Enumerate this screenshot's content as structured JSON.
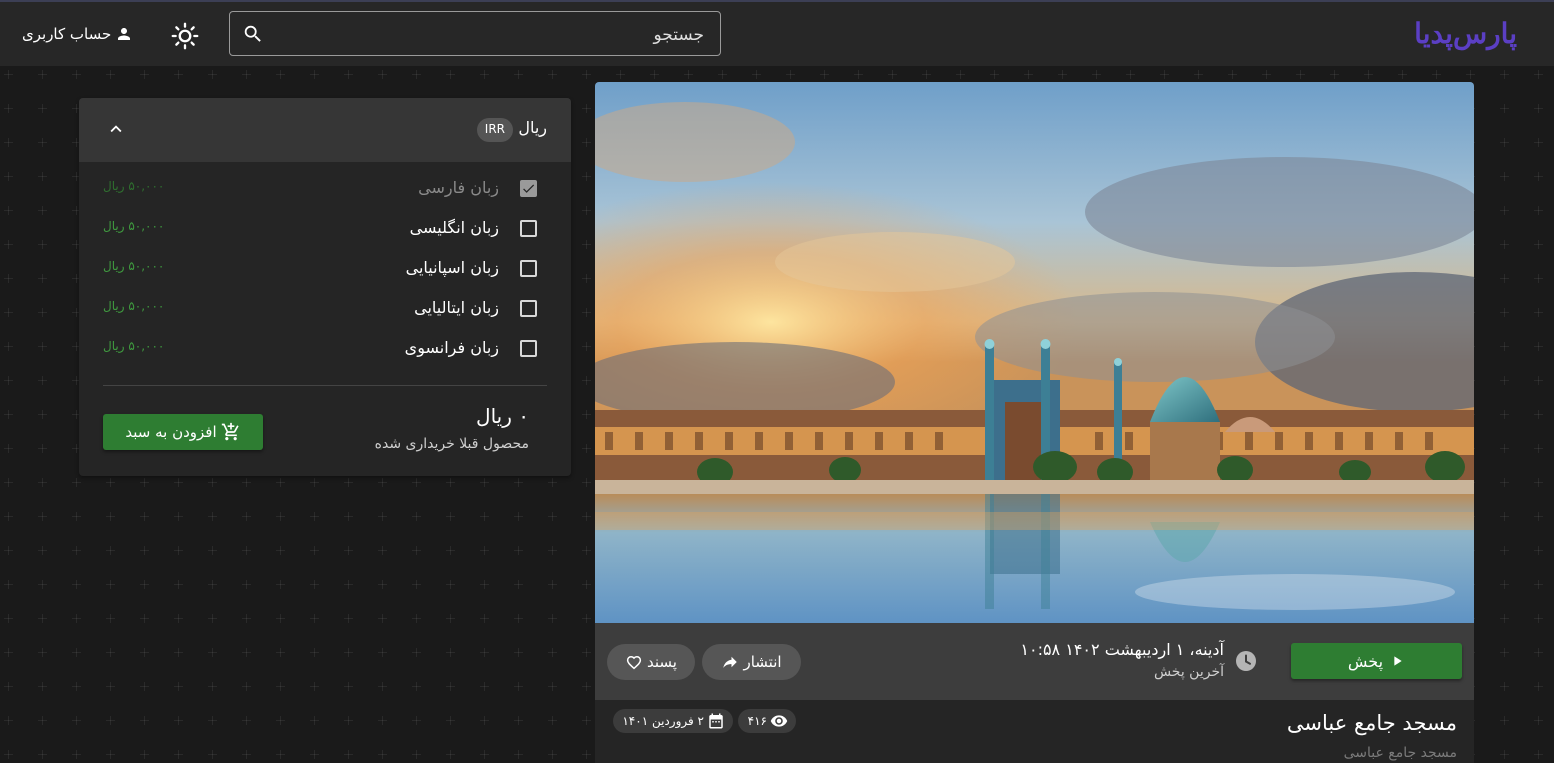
{
  "header": {
    "logo_text": "پارس‌پدیا",
    "search_placeholder": "جستجو",
    "account_label": "حساب کاربری"
  },
  "purchase": {
    "currency_name": "ریال",
    "currency_code": "IRR",
    "options": [
      {
        "label": "زبان فارسی",
        "price": "۵۰,۰۰۰ ریال",
        "checked": true,
        "disabled": true
      },
      {
        "label": "زبان انگلیسی",
        "price": "۵۰,۰۰۰ ریال",
        "checked": false,
        "disabled": false
      },
      {
        "label": "زبان اسپانیایی",
        "price": "۵۰,۰۰۰ ریال",
        "checked": false,
        "disabled": false
      },
      {
        "label": "زبان ایتالیایی",
        "price": "۵۰,۰۰۰ ریال",
        "checked": false,
        "disabled": false
      },
      {
        "label": "زبان فرانسوی",
        "price": "۵۰,۰۰۰ ریال",
        "checked": false,
        "disabled": false
      }
    ],
    "total": "۰ ریال",
    "total_note": "محصول قبلا خریداری شده",
    "add_to_cart_label": "افزودن به سبد"
  },
  "video": {
    "play_label": "پخش",
    "last_play_date": "آدینه، ۱ اردیبهشت ۱۴۰۲ ۱۰:۵۸",
    "last_play_label": "آخرین پخش",
    "share_label": "انتشار",
    "like_label": "پسند",
    "title": "مسجد جامع عباسی",
    "subtitle": "مسجد جامع عباسی",
    "views": "۴۱۶",
    "date": "۲ فروردین ۱۴۰۱"
  },
  "colors": {
    "accent_green": "#2e7d32",
    "logo_purple": "#5b3fc4",
    "header_bg": "#272727",
    "page_bg": "#1a1a1a"
  }
}
